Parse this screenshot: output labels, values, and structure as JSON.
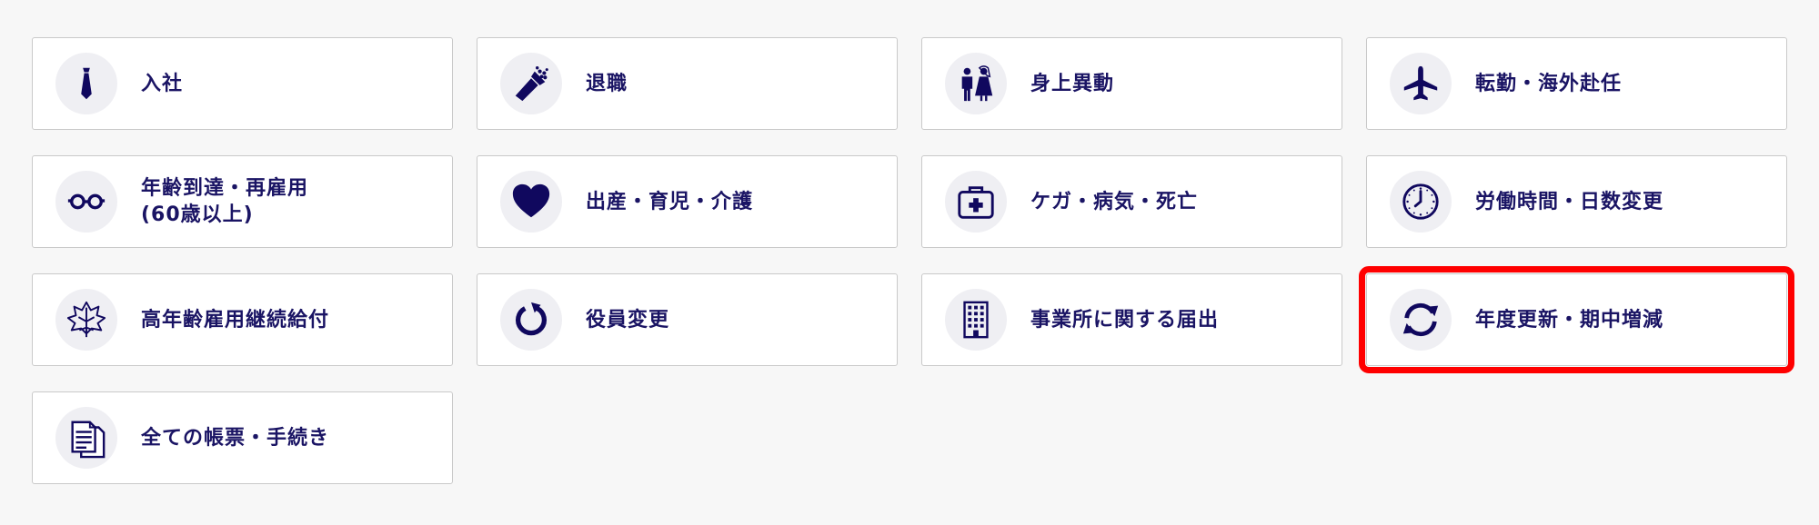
{
  "colors": {
    "text": "#1a1464",
    "icon": "#10085e",
    "icon_bg": "#efeff3",
    "card_border": "#c9c9c9",
    "page_bg": "#f7f7f7",
    "highlight": "#ff0000"
  },
  "menu": {
    "items": [
      {
        "label": "入社",
        "icon": "necktie-icon"
      },
      {
        "label": "退職",
        "icon": "bouquet-icon"
      },
      {
        "label": "身上異動",
        "icon": "couple-icon"
      },
      {
        "label": "転勤・海外赴任",
        "icon": "airplane-icon"
      },
      {
        "label": "年齢到達・再雇用",
        "label2": "(60歳以上)",
        "icon": "glasses-icon"
      },
      {
        "label": "出産・育児・介護",
        "icon": "heart-icon"
      },
      {
        "label": "ケガ・病気・死亡",
        "icon": "first-aid-kit-icon"
      },
      {
        "label": "労働時間・日数変更",
        "icon": "clock-icon"
      },
      {
        "label": "高年齢雇用継続給付",
        "icon": "maple-leaf-icon"
      },
      {
        "label": "役員変更",
        "icon": "rotate-arrow-icon"
      },
      {
        "label": "事業所に関する届出",
        "icon": "building-icon"
      },
      {
        "label": "年度更新・期中増減",
        "icon": "refresh-arrows-icon",
        "highlighted": true
      },
      {
        "label": "全ての帳票・手続き",
        "icon": "documents-icon"
      }
    ]
  }
}
